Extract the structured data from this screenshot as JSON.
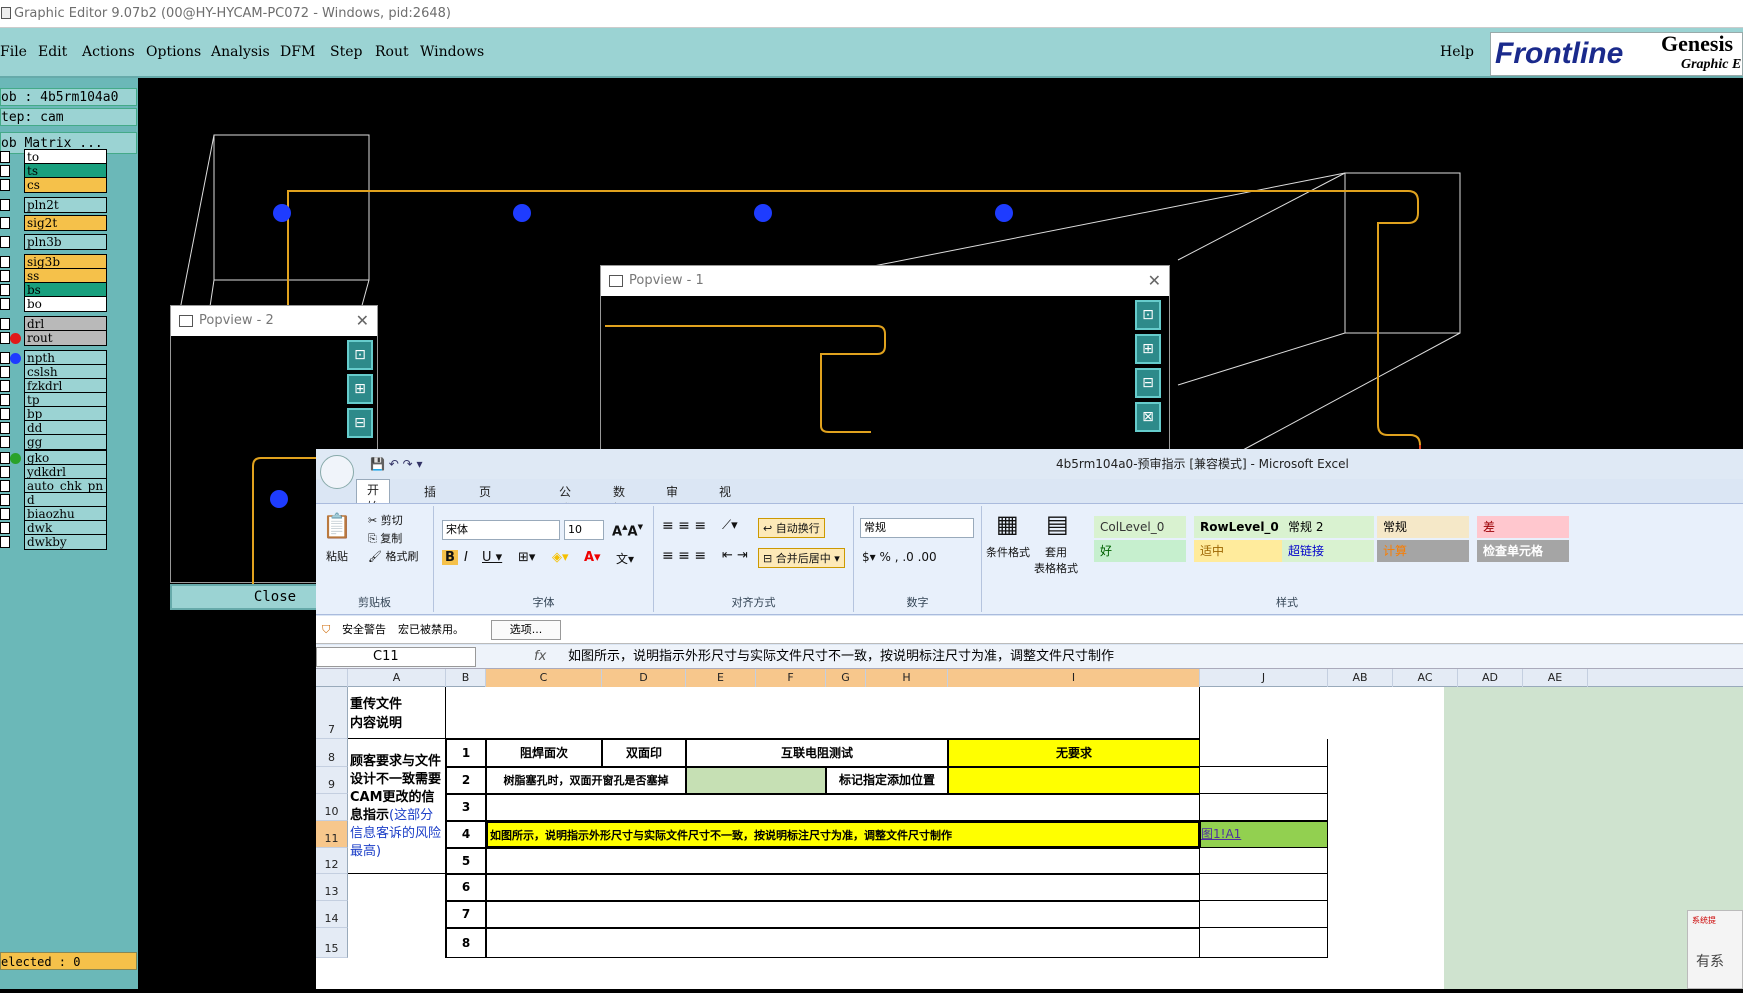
{
  "window": {
    "title": "Graphic Editor 9.07b2 (00@HY-HYCAM-PC072 - Windows, pid:2648)"
  },
  "menu": {
    "items": [
      "File",
      "Edit",
      "Actions",
      "Options",
      "Analysis",
      "DFM",
      "Step",
      "Rout",
      "Windows"
    ],
    "help": "Help"
  },
  "logo": {
    "brand": "Frontline",
    "product": "Genesis",
    "sub": "Graphic E"
  },
  "job": {
    "job": "ob : 4b5rm104a0",
    "step": "tep: cam",
    "matrix": "ob Matrix ..."
  },
  "layers": [
    {
      "name": "to",
      "color": "#ffffff"
    },
    {
      "name": "ts",
      "color": "#19a07e"
    },
    {
      "name": "cs",
      "color": "#f5c14a"
    },
    {
      "name": "pln2t",
      "color": "#9bd3d3"
    },
    {
      "name": "sig2t",
      "color": "#f5c14a"
    },
    {
      "name": "pln3b",
      "color": "#9bd3d3"
    },
    {
      "name": "sig3b",
      "color": "#f5c14a"
    },
    {
      "name": "ss",
      "color": "#f5c14a"
    },
    {
      "name": "bs",
      "color": "#19a07e"
    },
    {
      "name": "bo",
      "color": "#ffffff"
    },
    {
      "name": "drl",
      "color": "#b9b9b9"
    },
    {
      "name": "rout",
      "color": "#b9b9b9"
    },
    {
      "name": "npth",
      "color": "#9bd3d3"
    },
    {
      "name": "cslsh",
      "color": "#9bd3d3"
    },
    {
      "name": "fzkdrl",
      "color": "#9bd3d3"
    },
    {
      "name": "tp",
      "color": "#9bd3d3"
    },
    {
      "name": "bp",
      "color": "#9bd3d3"
    },
    {
      "name": "dd",
      "color": "#9bd3d3"
    },
    {
      "name": "gg",
      "color": "#9bd3d3"
    },
    {
      "name": "gko",
      "color": "#9bd3d3"
    },
    {
      "name": "ydkdrl",
      "color": "#9bd3d3"
    },
    {
      "name": "auto_chk_pn",
      "color": "#9bd3d3"
    },
    {
      "name": "d",
      "color": "#9bd3d3"
    },
    {
      "name": "biaozhu",
      "color": "#9bd3d3"
    },
    {
      "name": "dwk",
      "color": "#9bd3d3"
    },
    {
      "name": "dwkby",
      "color": "#9bd3d3"
    }
  ],
  "selected": "elected : 0",
  "popview1": {
    "title": "Popview - 1"
  },
  "popview2": {
    "title": "Popview - 2",
    "close": "Close"
  },
  "excel": {
    "title": "4b5rm104a0-预审指示  [兼容模式] - Microsoft Excel",
    "tabs": [
      "开始",
      "插入",
      "页面布局",
      "公式",
      "数据",
      "审阅",
      "视图"
    ],
    "clipboard": {
      "paste": "粘贴",
      "cut": "剪切",
      "copy": "复制",
      "format": "格式刷",
      "label": "剪贴板"
    },
    "font": {
      "name": "宋体",
      "size": "10",
      "label": "字体"
    },
    "align": {
      "wrap": "自动换行",
      "merge": "合并后居中",
      "label": "对齐方式"
    },
    "number": {
      "format": "常规",
      "label": "数字"
    },
    "styles": {
      "cond": "条件格式",
      "table": "套用\n表格格式",
      "label": "样式",
      "items": [
        {
          "text": "ColLevel_0",
          "bg": "#d9f2d0",
          "color": "#333"
        },
        {
          "text": "RowLevel_0",
          "bg": "#d9f2d0",
          "color": "#000",
          "bold": true
        },
        {
          "text": "常规 2",
          "bg": "#d9f2d0",
          "color": "#000"
        },
        {
          "text": "常规",
          "bg": "#f5e8c8",
          "color": "#000"
        },
        {
          "text": "差",
          "bg": "#ffc7ce",
          "color": "#9c0006"
        },
        {
          "text": "好",
          "bg": "#c6efce",
          "color": "#006100"
        },
        {
          "text": "适中",
          "bg": "#ffeb9c",
          "color": "#9c6500"
        },
        {
          "text": "超链接",
          "bg": "#d9f2d0",
          "color": "#0000cc"
        },
        {
          "text": "计算",
          "bg": "#a5a5a5",
          "color": "#fa7d00"
        },
        {
          "text": "检查单元格",
          "bg": "#a5a5a5",
          "color": "#ffffff",
          "bold": true
        }
      ]
    },
    "security": {
      "warn": "安全警告",
      "msg": "宏已被禁用。",
      "btn": "选项..."
    },
    "namebox": "C11",
    "formula": "如图所示，说明指示外形尺寸与实际文件尺寸不一致，按说明标注尺寸为准，调整文件尺寸制作",
    "columns": [
      "A",
      "B",
      "C",
      "D",
      "E",
      "F",
      "G",
      "H",
      "I",
      "J",
      "AB",
      "AC",
      "AD",
      "AE"
    ],
    "rows": [
      "7",
      "8",
      "9",
      "10",
      "11",
      "12",
      "13",
      "14",
      "15"
    ],
    "a7": "重传文件\n内容说明",
    "a8_black": "顾客要求与文件设计不一致需要CAM更改的信息指示",
    "a8_blue": "(这部分信息客诉的风险最高)",
    "b_nums": [
      "1",
      "2",
      "3",
      "4",
      "5",
      "6",
      "7",
      "8"
    ],
    "r8": {
      "c": "阻焊面次",
      "d": "双面印",
      "efh": "互联电阻测试",
      "i": "无要求"
    },
    "r9": {
      "c": "树脂塞孔时，双面开窗孔是否塞掉",
      "h": "标记指定添加位置"
    },
    "r11": {
      "c": "如图所示，说明指示外形尺寸与实际文件尺寸不一致，按说明标注尺寸为准，调整文件尺寸制作",
      "j": "图1!A1"
    }
  },
  "notify": {
    "title": "系统提",
    "text": "有系"
  }
}
